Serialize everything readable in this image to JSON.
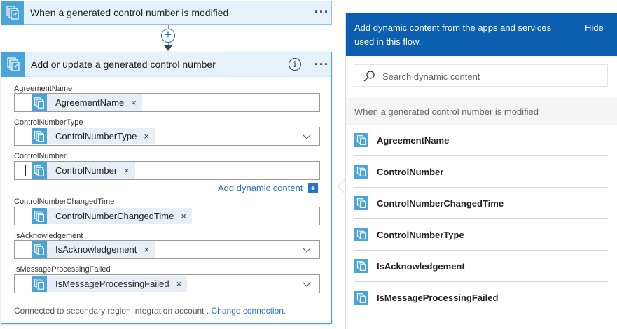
{
  "trigger": {
    "title": "When a generated control number is modified",
    "icon": "integration-account-icon"
  },
  "action": {
    "title": "Add or update a generated control number",
    "fields": [
      {
        "label": "AgreementName",
        "token": "AgreementName",
        "has_dropdown": false,
        "has_cursor": false
      },
      {
        "label": "ControlNumberType",
        "token": "ControlNumberType",
        "has_dropdown": true,
        "has_cursor": false
      },
      {
        "label": "ControlNumber",
        "token": "ControlNumber",
        "has_dropdown": false,
        "has_cursor": true
      },
      {
        "label": "ControlNumberChangedTime",
        "token": "ControlNumberChangedTime",
        "has_dropdown": false,
        "has_cursor": false
      },
      {
        "label": "IsAcknowledgement",
        "token": "IsAcknowledgement",
        "has_dropdown": true,
        "has_cursor": false
      },
      {
        "label": "IsMessageProcessingFailed",
        "token": "IsMessageProcessingFailed",
        "has_dropdown": true,
        "has_cursor": false
      }
    ],
    "add_dynamic_label": "Add dynamic content",
    "add_dynamic_badge": "+",
    "footer_text": "Connected to secondary region integration account . ",
    "footer_link": "Change connection."
  },
  "dynamic_panel": {
    "header_message": "Add dynamic content from the apps and services used in this flow.",
    "hide_label": "Hide",
    "search_placeholder": "Search dynamic content",
    "section_title": "When a generated control number is modified",
    "items": [
      {
        "label": "AgreementName"
      },
      {
        "label": "ControlNumber"
      },
      {
        "label": "ControlNumberChangedTime"
      },
      {
        "label": "ControlNumberType"
      },
      {
        "label": "IsAcknowledgement"
      },
      {
        "label": "IsMessageProcessingFailed"
      }
    ]
  },
  "colors": {
    "accent": "#0c5eb0",
    "link": "#2a73c7",
    "icon_bg": "#4ba4d8",
    "card_header": "#e6f2fb"
  }
}
